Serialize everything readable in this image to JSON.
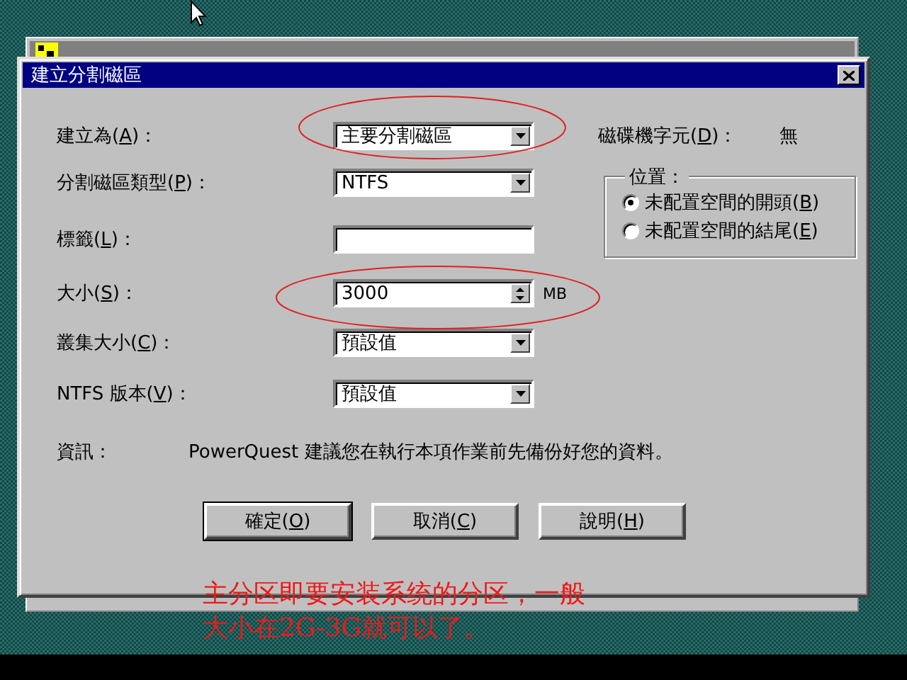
{
  "dialog": {
    "title": "建立分割磁區"
  },
  "fields": [
    {
      "kind": "combo",
      "label_start": "建立為(",
      "hotkey": "A",
      "label_end": ")：",
      "value": "主要分割磁區"
    },
    {
      "kind": "combo",
      "label_start": "分割磁區類型(",
      "hotkey": "P",
      "label_end": ")：",
      "value": "NTFS"
    },
    {
      "kind": "text",
      "label_start": "標籤(",
      "hotkey": "L",
      "label_end": ")："
    },
    {
      "kind": "spin",
      "label_start": "大小(",
      "hotkey": "S",
      "label_end": ")：",
      "value": "3000",
      "unit": "MB"
    },
    {
      "kind": "combo",
      "label_start": "叢集大小(",
      "hotkey": "C",
      "label_end": ")：",
      "value": "預設值"
    },
    {
      "kind": "combo",
      "label_start": "NTFS 版本(",
      "hotkey": "V",
      "label_end": ")：",
      "value": "預設值"
    }
  ],
  "drive_letter": {
    "label_start": "磁碟機字元(",
    "hotkey": "D",
    "label_end": ")：",
    "value": "無"
  },
  "position_group": {
    "title": "位置：",
    "options": [
      {
        "label_start": "未配置空間的開頭(",
        "hotkey": "B",
        "label_end": ")",
        "selected": true
      },
      {
        "label_start": "未配置空間的結尾(",
        "hotkey": "E",
        "label_end": ")",
        "selected": false
      }
    ]
  },
  "info": {
    "label": "資訊：",
    "text": "PowerQuest 建議您在執行本項作業前先備份好您的資料。"
  },
  "buttons": [
    {
      "label_start": "確定(",
      "hotkey": "O",
      "label_end": ")",
      "default": true
    },
    {
      "label_start": "取消(",
      "hotkey": "C",
      "label_end": ")",
      "default": false
    },
    {
      "label_start": "說明(",
      "hotkey": "H",
      "label_end": ")",
      "default": false
    }
  ],
  "annotation": {
    "lines": [
      "主分区即要安装系统的分区，一般",
      "大小在2G-3G就可以了。"
    ]
  }
}
